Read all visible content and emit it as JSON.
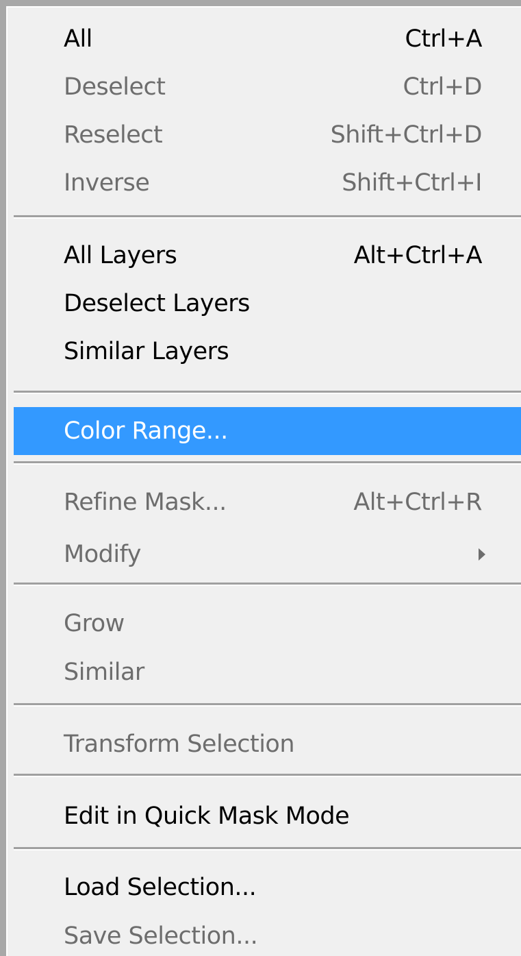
{
  "menu": {
    "items": [
      {
        "label": "All",
        "shortcut": "Ctrl+A",
        "enabled": true
      },
      {
        "label": "Deselect",
        "shortcut": "Ctrl+D",
        "enabled": false
      },
      {
        "label": "Reselect",
        "shortcut": "Shift+Ctrl+D",
        "enabled": false
      },
      {
        "label": "Inverse",
        "shortcut": "Shift+Ctrl+I",
        "enabled": false
      },
      {
        "label": "All Layers",
        "shortcut": "Alt+Ctrl+A",
        "enabled": true
      },
      {
        "label": "Deselect Layers",
        "shortcut": "",
        "enabled": true
      },
      {
        "label": "Similar Layers",
        "shortcut": "",
        "enabled": true
      },
      {
        "label": "Color Range...",
        "shortcut": "",
        "enabled": true,
        "highlighted": true
      },
      {
        "label": "Refine Mask...",
        "shortcut": "Alt+Ctrl+R",
        "enabled": false
      },
      {
        "label": "Modify",
        "shortcut": "",
        "enabled": false,
        "submenu": true
      },
      {
        "label": "Grow",
        "shortcut": "",
        "enabled": false
      },
      {
        "label": "Similar",
        "shortcut": "",
        "enabled": false
      },
      {
        "label": "Transform Selection",
        "shortcut": "",
        "enabled": false
      },
      {
        "label": "Edit in Quick Mask Mode",
        "shortcut": "",
        "enabled": true
      },
      {
        "label": "Load Selection...",
        "shortcut": "",
        "enabled": true
      },
      {
        "label": "Save Selection...",
        "shortcut": "",
        "enabled": false
      }
    ],
    "submenu_icon": "submenu-arrow-icon",
    "colors": {
      "background": "#f0f0f0",
      "highlight": "#3399ff",
      "enabled_text": "#000000",
      "disabled_text": "#6d6d6d"
    }
  }
}
